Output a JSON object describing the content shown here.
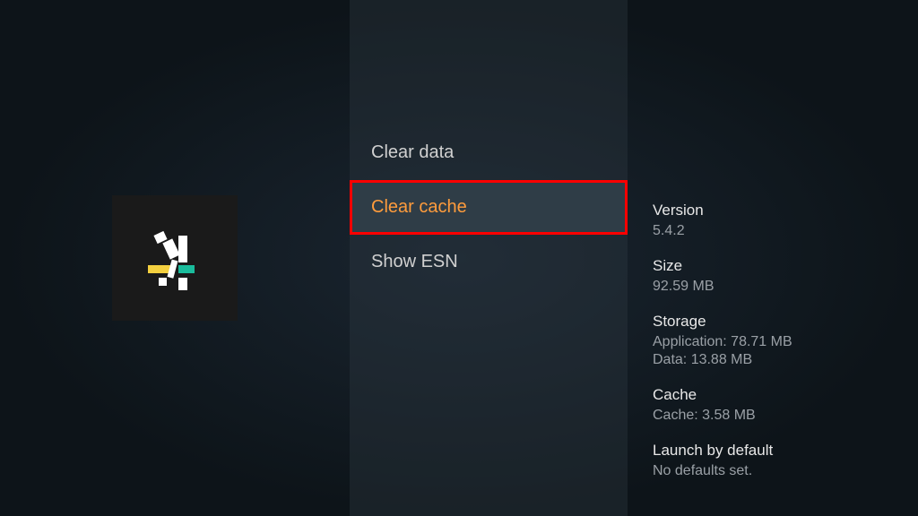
{
  "menu": {
    "items": [
      {
        "label": "Clear data"
      },
      {
        "label": "Clear cache"
      },
      {
        "label": "Show ESN"
      }
    ]
  },
  "info": {
    "version_label": "Version",
    "version_value": "5.4.2",
    "size_label": "Size",
    "size_value": "92.59 MB",
    "storage_label": "Storage",
    "storage_app": "Application: 78.71 MB",
    "storage_data": "Data: 13.88 MB",
    "cache_label": "Cache",
    "cache_value": "Cache: 3.58 MB",
    "launch_label": "Launch by default",
    "launch_value": "No defaults set."
  }
}
